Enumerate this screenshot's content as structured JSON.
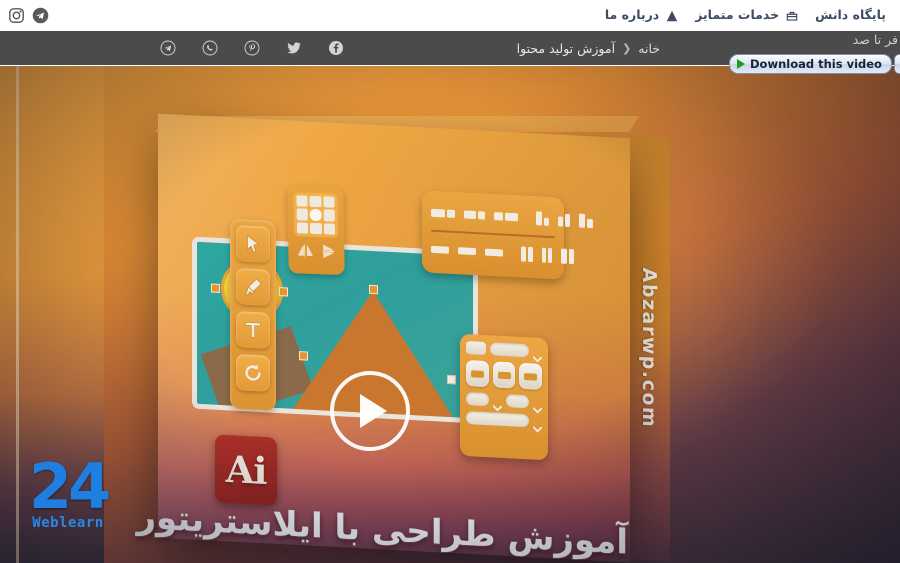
{
  "topbar": {
    "nav_items": [
      {
        "label": "پایگاه دانش",
        "icon": "book-icon"
      },
      {
        "label": "خدمات متمایز",
        "icon": "briefcase-icon"
      },
      {
        "label": "درباره ما",
        "icon": "triangle-icon"
      }
    ],
    "social": [
      {
        "name": "instagram-icon",
        "label": "Instagram"
      },
      {
        "name": "telegram-icon",
        "label": "Telegram"
      }
    ]
  },
  "darkbar": {
    "breadcrumb": {
      "home": "خانه",
      "separator": "❮",
      "current": "آموزش تولید محتوا"
    },
    "share": [
      {
        "name": "telegram-share-icon",
        "label": "Telegram"
      },
      {
        "name": "whatsapp-share-icon",
        "label": "WhatsApp"
      },
      {
        "name": "pinterest-share-icon",
        "label": "Pinterest"
      },
      {
        "name": "twitter-share-icon",
        "label": "Twitter"
      },
      {
        "name": "facebook-share-icon",
        "label": "Facebook"
      }
    ],
    "cut_text": "فر تا صد"
  },
  "download_overlay": {
    "button_label": "Download this video",
    "help_label": "?",
    "close_label": "X"
  },
  "poster": {
    "box_spine_text": "Abzarwp.com",
    "box_title": "آموزش طراحی با ایلاستریتور",
    "ai_logo_text": "Ai",
    "play_label": "Play",
    "watermark": {
      "number": "24",
      "word": "Weblearn"
    },
    "tools": [
      {
        "name": "selection-arrow-tool",
        "label": "Selection"
      },
      {
        "name": "pen-tool",
        "label": "Pen"
      },
      {
        "name": "type-tool",
        "label": "T"
      },
      {
        "name": "rotate-tool",
        "label": "Rotate"
      }
    ]
  },
  "colors": {
    "topbar_bg": "#ffffff",
    "nav_text": "#3e4b64",
    "darkbar_bg": "#4b4b4b",
    "darkbar_text": "#d8d8d8",
    "poster_orange": "#e79e3c",
    "poster_dark": "#33303f",
    "watermark_blue": "#1f7fe0",
    "ai_red": "#b3322b",
    "screen_teal": "#2fa7a0",
    "download_green": "#1f9c1f"
  }
}
